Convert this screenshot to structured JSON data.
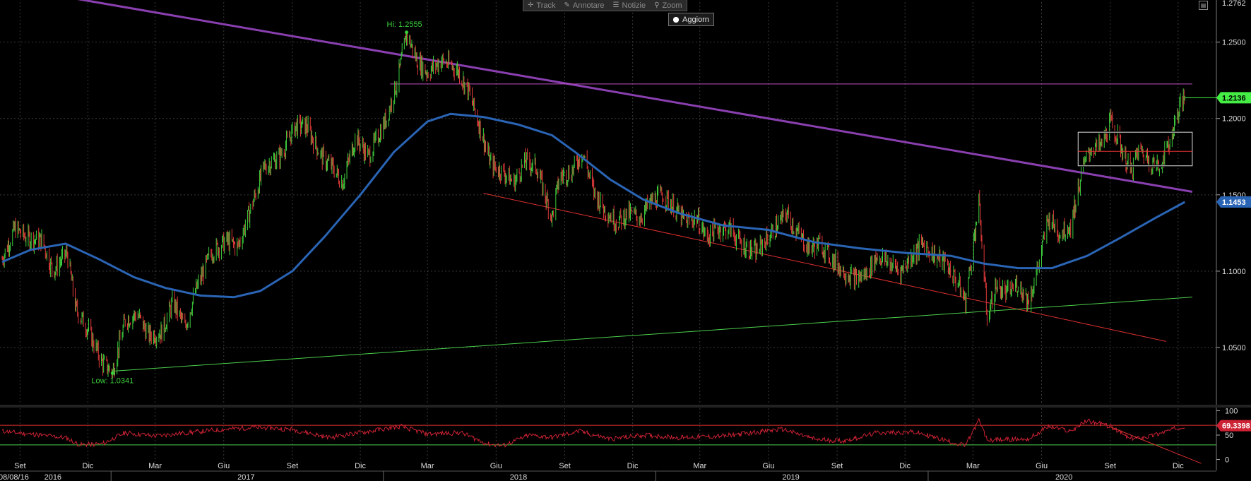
{
  "toolbar": {
    "track_label": "Track",
    "annotate_label": "Annotare",
    "news_label": "Notizie",
    "zoom_label": "Zoom",
    "refresh_label": "Aggiorn"
  },
  "colors": {
    "background": "#000000",
    "grid": "#3a3a3a",
    "up_candle": "#3ccf3c",
    "down_candle": "#e03a3a",
    "moving_average": "#2a64b4",
    "purple_trendline": "#8a3fb0",
    "magenta_level": "#c050c8",
    "red_trendline": "#e03030",
    "green_trendline": "#4cd04c",
    "last_price_box": "#44ee44",
    "ma_price_box": "#2a64b4",
    "rsi_line": "#cc2233",
    "rsi_box": "#cc2233"
  },
  "chart_data": [
    {
      "type": "candlestick",
      "title": "",
      "y_axis": {
        "side": "right",
        "range": [
          1.013,
          1.2762
        ],
        "ticks": [
          "1.0500",
          "1.1000",
          "1.1500",
          "1.2000",
          "1.2500"
        ],
        "top_label": "1.2762"
      },
      "grid": true,
      "x_axis": {
        "start_date_label": "08/08/16",
        "month_ticks": [
          {
            "label": "Set",
            "date": "2016-09"
          },
          {
            "label": "Dic",
            "date": "2016-12"
          },
          {
            "label": "Mar",
            "date": "2017-03"
          },
          {
            "label": "Giu",
            "date": "2017-06"
          },
          {
            "label": "Set",
            "date": "2017-09"
          },
          {
            "label": "Dic",
            "date": "2017-12"
          },
          {
            "label": "Mar",
            "date": "2018-03"
          },
          {
            "label": "Giu",
            "date": "2018-06"
          },
          {
            "label": "Set",
            "date": "2018-09"
          },
          {
            "label": "Dic",
            "date": "2018-12"
          },
          {
            "label": "Mar",
            "date": "2019-03"
          },
          {
            "label": "Giu",
            "date": "2019-06"
          },
          {
            "label": "Set",
            "date": "2019-09"
          },
          {
            "label": "Dic",
            "date": "2019-12"
          },
          {
            "label": "Mar",
            "date": "2020-03"
          },
          {
            "label": "Giu",
            "date": "2020-06"
          },
          {
            "label": "Set",
            "date": "2020-09"
          },
          {
            "label": "Dic",
            "date": "2020-12"
          }
        ],
        "year_labels": [
          "2016",
          "2017",
          "2018",
          "2019",
          "2020"
        ]
      },
      "price_path": [
        [
          "2016-08-08",
          1.108
        ],
        [
          "2016-08-25",
          1.128
        ],
        [
          "2016-09-10",
          1.122
        ],
        [
          "2016-10-01",
          1.12
        ],
        [
          "2016-10-15",
          1.1
        ],
        [
          "2016-11-03",
          1.112
        ],
        [
          "2016-11-15",
          1.075
        ],
        [
          "2016-12-01",
          1.062
        ],
        [
          "2016-12-20",
          1.04
        ],
        [
          "2017-01-03",
          1.0341
        ],
        [
          "2017-01-20",
          1.068
        ],
        [
          "2017-02-05",
          1.072
        ],
        [
          "2017-02-20",
          1.058
        ],
        [
          "2017-03-10",
          1.06
        ],
        [
          "2017-03-25",
          1.08
        ],
        [
          "2017-04-10",
          1.063
        ],
        [
          "2017-04-25",
          1.088
        ],
        [
          "2017-05-15",
          1.112
        ],
        [
          "2017-06-05",
          1.12
        ],
        [
          "2017-06-20",
          1.116
        ],
        [
          "2017-07-10",
          1.145
        ],
        [
          "2017-07-25",
          1.168
        ],
        [
          "2017-08-15",
          1.175
        ],
        [
          "2017-09-05",
          1.195
        ],
        [
          "2017-09-20",
          1.195
        ],
        [
          "2017-10-10",
          1.175
        ],
        [
          "2017-10-25",
          1.168
        ],
        [
          "2017-11-07",
          1.158
        ],
        [
          "2017-11-25",
          1.188
        ],
        [
          "2017-12-12",
          1.175
        ],
        [
          "2018-01-05",
          1.2
        ],
        [
          "2018-01-20",
          1.225
        ],
        [
          "2018-02-01",
          1.2555
        ],
        [
          "2018-02-15",
          1.238
        ],
        [
          "2018-03-01",
          1.23
        ],
        [
          "2018-03-20",
          1.238
        ],
        [
          "2018-04-10",
          1.232
        ],
        [
          "2018-04-25",
          1.218
        ],
        [
          "2018-05-10",
          1.195
        ],
        [
          "2018-05-25",
          1.17
        ],
        [
          "2018-06-10",
          1.165
        ],
        [
          "2018-06-25",
          1.158
        ],
        [
          "2018-07-10",
          1.172
        ],
        [
          "2018-07-25",
          1.168
        ],
        [
          "2018-08-15",
          1.135
        ],
        [
          "2018-08-25",
          1.162
        ],
        [
          "2018-09-10",
          1.165
        ],
        [
          "2018-09-25",
          1.178
        ],
        [
          "2018-10-10",
          1.152
        ],
        [
          "2018-10-25",
          1.14
        ],
        [
          "2018-11-10",
          1.132
        ],
        [
          "2018-11-25",
          1.138
        ],
        [
          "2018-12-10",
          1.135
        ],
        [
          "2018-12-25",
          1.145
        ],
        [
          "2019-01-10",
          1.15
        ],
        [
          "2019-01-25",
          1.142
        ],
        [
          "2019-02-10",
          1.132
        ],
        [
          "2019-02-25",
          1.135
        ],
        [
          "2019-03-10",
          1.122
        ],
        [
          "2019-03-25",
          1.128
        ],
        [
          "2019-04-10",
          1.128
        ],
        [
          "2019-04-25",
          1.118
        ],
        [
          "2019-05-15",
          1.112
        ],
        [
          "2019-06-05",
          1.125
        ],
        [
          "2019-06-25",
          1.138
        ],
        [
          "2019-07-10",
          1.125
        ],
        [
          "2019-07-25",
          1.115
        ],
        [
          "2019-08-10",
          1.118
        ],
        [
          "2019-08-25",
          1.108
        ],
        [
          "2019-09-10",
          1.1
        ],
        [
          "2019-09-25",
          1.095
        ],
        [
          "2019-10-10",
          1.098
        ],
        [
          "2019-10-25",
          1.11
        ],
        [
          "2019-11-10",
          1.105
        ],
        [
          "2019-11-25",
          1.1
        ],
        [
          "2019-12-10",
          1.11
        ],
        [
          "2019-12-25",
          1.118
        ],
        [
          "2020-01-10",
          1.11
        ],
        [
          "2020-01-25",
          1.105
        ],
        [
          "2020-02-10",
          1.092
        ],
        [
          "2020-02-20",
          1.08
        ],
        [
          "2020-03-09",
          1.145
        ],
        [
          "2020-03-20",
          1.07
        ],
        [
          "2020-04-01",
          1.09
        ],
        [
          "2020-04-15",
          1.085
        ],
        [
          "2020-04-30",
          1.092
        ],
        [
          "2020-05-15",
          1.08
        ],
        [
          "2020-05-30",
          1.108
        ],
        [
          "2020-06-10",
          1.135
        ],
        [
          "2020-06-25",
          1.125
        ],
        [
          "2020-07-10",
          1.13
        ],
        [
          "2020-07-25",
          1.165
        ],
        [
          "2020-08-05",
          1.18
        ],
        [
          "2020-08-20",
          1.182
        ],
        [
          "2020-09-01",
          1.198
        ],
        [
          "2020-09-15",
          1.182
        ],
        [
          "2020-09-28",
          1.165
        ],
        [
          "2020-10-10",
          1.18
        ],
        [
          "2020-10-25",
          1.172
        ],
        [
          "2020-11-05",
          1.168
        ],
        [
          "2020-11-20",
          1.185
        ],
        [
          "2020-12-01",
          1.205
        ],
        [
          "2020-12-10",
          1.2136
        ]
      ],
      "moving_average_path": [
        [
          "2016-08-08",
          1.106
        ],
        [
          "2016-09-15",
          1.114
        ],
        [
          "2016-11-01",
          1.118
        ],
        [
          "2016-12-15",
          1.108
        ],
        [
          "2017-02-01",
          1.096
        ],
        [
          "2017-03-15",
          1.089
        ],
        [
          "2017-05-01",
          1.084
        ],
        [
          "2017-06-15",
          1.083
        ],
        [
          "2017-07-20",
          1.087
        ],
        [
          "2017-09-01",
          1.1
        ],
        [
          "2017-10-15",
          1.123
        ],
        [
          "2017-12-01",
          1.15
        ],
        [
          "2018-01-15",
          1.178
        ],
        [
          "2018-03-01",
          1.198
        ],
        [
          "2018-04-01",
          1.203
        ],
        [
          "2018-05-15",
          1.201
        ],
        [
          "2018-07-01",
          1.196
        ],
        [
          "2018-08-15",
          1.189
        ],
        [
          "2018-09-15",
          1.178
        ],
        [
          "2018-11-01",
          1.16
        ],
        [
          "2018-12-15",
          1.147
        ],
        [
          "2019-02-01",
          1.138
        ],
        [
          "2019-04-01",
          1.13
        ],
        [
          "2019-06-01",
          1.127
        ],
        [
          "2019-08-01",
          1.119
        ],
        [
          "2019-10-01",
          1.115
        ],
        [
          "2019-12-01",
          1.112
        ],
        [
          "2020-02-01",
          1.11
        ],
        [
          "2020-03-15",
          1.105
        ],
        [
          "2020-05-01",
          1.102
        ],
        [
          "2020-06-15",
          1.102
        ],
        [
          "2020-08-01",
          1.11
        ],
        [
          "2020-09-15",
          1.122
        ],
        [
          "2020-11-01",
          1.135
        ],
        [
          "2020-12-10",
          1.1453
        ]
      ],
      "trendlines": [
        {
          "color_key": "purple_trendline",
          "from": [
            "2016-07-01",
            1.29
          ],
          "to": [
            "2020-12-20",
            1.152
          ],
          "width": 3
        },
        {
          "color_key": "magenta_level",
          "from": [
            "2018-01-10",
            1.2226
          ],
          "to": [
            "2020-12-20",
            1.2226
          ],
          "width": 1
        },
        {
          "color_key": "red_trendline",
          "from": [
            "2018-05-15",
            1.151
          ],
          "to": [
            "2020-11-15",
            1.054
          ],
          "width": 1
        },
        {
          "color_key": "green_trendline",
          "from": [
            "2017-01-03",
            1.0345
          ],
          "to": [
            "2020-12-20",
            1.083
          ],
          "width": 1
        }
      ],
      "box": {
        "from": [
          "2020-07-20",
          1.191
        ],
        "to": [
          "2020-12-20",
          1.169
        ],
        "mid": 1.1785
      },
      "annotations": [
        {
          "text": "Hi: 1.2555",
          "date": "2018-02-01",
          "value": 1.2555
        },
        {
          "text": "Low: 1.0341",
          "date": "2017-01-03",
          "value": 1.0341
        }
      ],
      "last_price_label": "1.2136",
      "ma_price_label": "1.1453"
    },
    {
      "type": "line",
      "title": "",
      "y_axis": {
        "range": [
          -5,
          105
        ],
        "ticks": [
          "0",
          "50",
          "100"
        ]
      },
      "reference_levels": [
        {
          "value": 70,
          "color_key": "red_trendline"
        },
        {
          "value": 30,
          "color_key": "green_trendline"
        }
      ],
      "rsi_path": [
        [
          "2016-08-08",
          58
        ],
        [
          "2016-09-15",
          52
        ],
        [
          "2016-11-01",
          45
        ],
        [
          "2016-11-20",
          30
        ],
        [
          "2016-12-20",
          32
        ],
        [
          "2017-01-20",
          55
        ],
        [
          "2017-03-01",
          48
        ],
        [
          "2017-04-15",
          55
        ],
        [
          "2017-05-15",
          60
        ],
        [
          "2017-07-15",
          66
        ],
        [
          "2017-09-01",
          62
        ],
        [
          "2017-10-20",
          45
        ],
        [
          "2017-12-01",
          55
        ],
        [
          "2018-01-25",
          68
        ],
        [
          "2018-03-01",
          52
        ],
        [
          "2018-04-15",
          55
        ],
        [
          "2018-05-20",
          32
        ],
        [
          "2018-06-10",
          28
        ],
        [
          "2018-07-15",
          50
        ],
        [
          "2018-08-15",
          45
        ],
        [
          "2018-09-20",
          58
        ],
        [
          "2018-11-01",
          42
        ],
        [
          "2018-12-15",
          50
        ],
        [
          "2019-02-01",
          45
        ],
        [
          "2019-04-01",
          48
        ],
        [
          "2019-06-20",
          62
        ],
        [
          "2019-08-01",
          42
        ],
        [
          "2019-09-10",
          38
        ],
        [
          "2019-10-25",
          55
        ],
        [
          "2019-12-15",
          56
        ],
        [
          "2020-02-20",
          28
        ],
        [
          "2020-03-09",
          80
        ],
        [
          "2020-03-20",
          40
        ],
        [
          "2020-05-15",
          42
        ],
        [
          "2020-06-10",
          68
        ],
        [
          "2020-07-10",
          58
        ],
        [
          "2020-08-01",
          80
        ],
        [
          "2020-09-01",
          68
        ],
        [
          "2020-09-28",
          42
        ],
        [
          "2020-10-25",
          48
        ],
        [
          "2020-11-20",
          60
        ],
        [
          "2020-12-10",
          69.3398
        ]
      ],
      "trendline": {
        "from": [
          "2020-09-01",
          67
        ],
        "to": [
          "2021-01-01",
          -8
        ]
      },
      "last_value_label": "69.3398"
    }
  ]
}
